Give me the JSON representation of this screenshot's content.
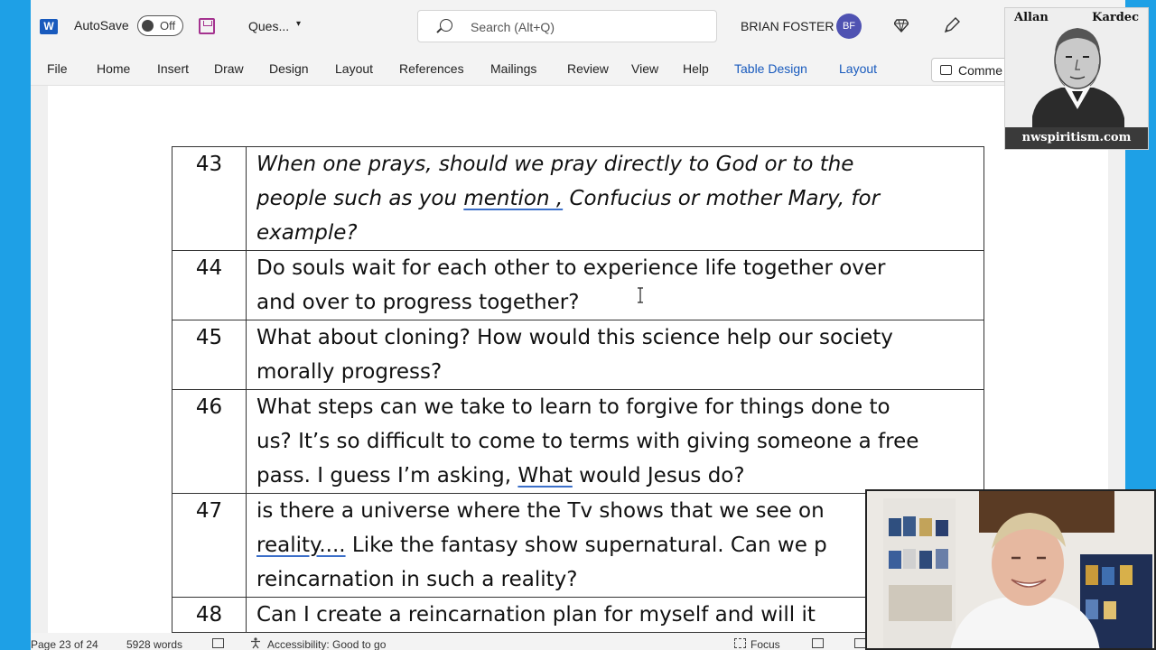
{
  "titlebar": {
    "app_icon": "word-icon",
    "app_icon_letter": "W",
    "autosave_label": "AutoSave",
    "autosave_state": "Off",
    "doc_name": "Ques...",
    "search_placeholder": "Search (Alt+Q)",
    "user_name": "BRIAN FOSTER",
    "user_initials": "BF"
  },
  "ribbon": {
    "tabs": [
      "File",
      "Home",
      "Insert",
      "Draw",
      "Design",
      "Layout",
      "References",
      "Mailings",
      "Review",
      "View",
      "Help",
      "Table Design",
      "Layout"
    ],
    "comments_label": "Comme"
  },
  "document": {
    "rows": [
      {
        "num": "43",
        "lines": [
          "When one prays, should we pray directly to God or to the",
          "people such as you |mention ,| Confucius or mother Mary, for",
          "example?"
        ]
      },
      {
        "num": "44",
        "lines": [
          "Do souls wait for each other to experience life together over",
          "and over to progress together?"
        ]
      },
      {
        "num": "45",
        "lines": [
          "What about cloning? How would this science help our society",
          "morally progress?"
        ]
      },
      {
        "num": "46",
        "lines": [
          "What steps can we take to learn to forgive for things done to",
          "us? It’s so difficult to come to terms with giving someone a free",
          "pass. I guess I’m asking, |What| would Jesus do?"
        ]
      },
      {
        "num": "47",
        "lines": [
          "is there a universe where the Tv shows that we see on",
          "|reality....| Like the fantasy show supernatural. Can we p",
          "reincarnation in such a reality?"
        ]
      },
      {
        "num": "48",
        "lines": [
          "Can I create a reincarnation plan for myself and will it"
        ]
      }
    ]
  },
  "statusbar": {
    "page": "Page 23 of 24",
    "words": "5928 words",
    "accessibility": "Accessibility: Good to go",
    "focus": "Focus"
  },
  "logo": {
    "left_word": "Allan",
    "right_word": "Kardec",
    "site": "nwspiritism.com"
  },
  "colors": {
    "word_blue": "#185abd",
    "accent_tab": "#185abd",
    "avatar": "#4f52b2",
    "desktop": "#1ea0e6"
  }
}
